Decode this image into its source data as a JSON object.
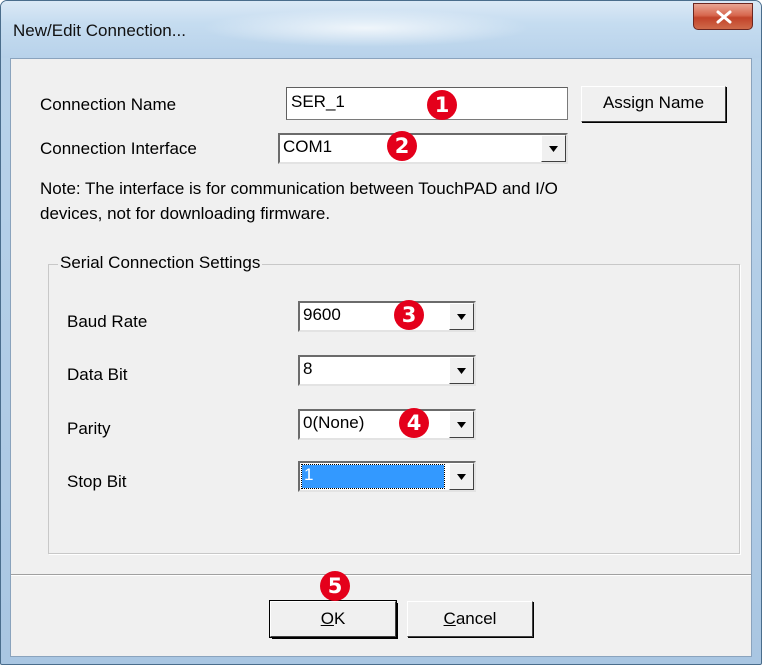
{
  "window": {
    "title": "New/Edit Connection..."
  },
  "connection_name": {
    "label": "Connection Name",
    "value": "SER_1",
    "assign_button": "Assign Name"
  },
  "connection_interface": {
    "label": "Connection Interface",
    "value": "COM1"
  },
  "note": {
    "line1": "Note: The interface is for communication between TouchPAD and I/O",
    "line2": "devices, not for downloading firmware."
  },
  "serial_group": {
    "title": "Serial Connection Settings",
    "baud_rate": {
      "label": "Baud Rate",
      "value": "9600"
    },
    "data_bit": {
      "label": "Data Bit",
      "value": "8"
    },
    "parity": {
      "label": "Parity",
      "value": "0(None)"
    },
    "stop_bit": {
      "label": "Stop Bit",
      "value": "1"
    }
  },
  "buttons": {
    "ok": {
      "mnemonic": "O",
      "rest": "K"
    },
    "cancel": {
      "mnemonic": "C",
      "rest": "ancel"
    }
  },
  "badges": [
    "1",
    "2",
    "3",
    "4",
    "5"
  ],
  "colors": {
    "badge": "#e4001b",
    "selection": "#3399ff",
    "close_button": "#c2432a"
  },
  "icons": {
    "close": "close-icon",
    "dropdown": "chevron-down-icon"
  }
}
